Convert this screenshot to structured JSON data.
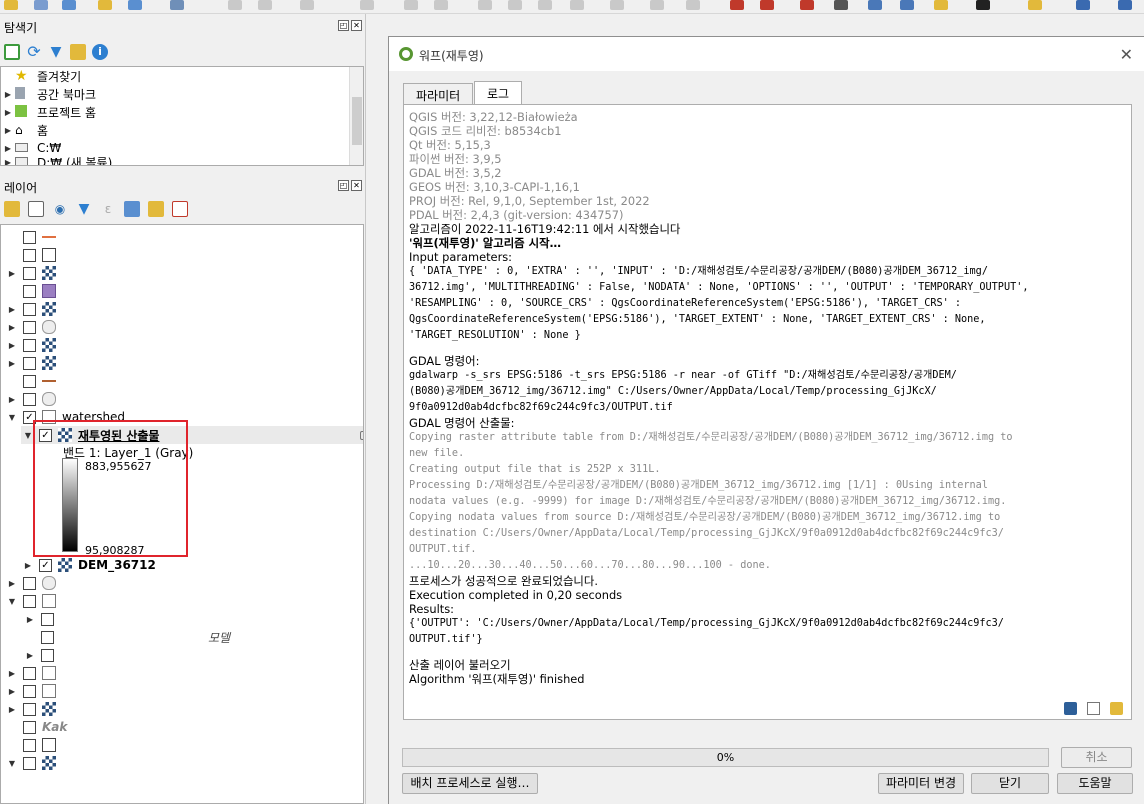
{
  "browser_panel": {
    "title": "탐색기",
    "items": [
      {
        "label": "즐겨찾기",
        "icon": "star-icon"
      },
      {
        "label": "공간 북마크",
        "icon": "bookmark-icon"
      },
      {
        "label": "프로젝트 홈",
        "icon": "project-home-icon"
      },
      {
        "label": "홈",
        "icon": "home-icon"
      },
      {
        "label": "C:₩",
        "icon": "drive-icon"
      },
      {
        "label": "D:₩ (새 볼륨)",
        "icon": "drive-icon"
      }
    ]
  },
  "layers_panel": {
    "title": "레이어",
    "watershed_label": "watershed",
    "selected_layer": "재투영된 산출물",
    "band_label": "밴드 1: Layer_1 (Gray)",
    "max_value": "883,955627",
    "min_value": "95,908287",
    "dem_layer": "DEM_36712",
    "model_label": "모델",
    "kaka_label": "Kak"
  },
  "dialog": {
    "title": "워프(재투영)",
    "tabs": [
      "파라미터",
      "로그"
    ],
    "active_tab": "로그",
    "log": {
      "header_lines": [
        "QGIS 버전: 3,22,12-Białowieża",
        "QGIS 코드 리비전: b8534cb1",
        "Qt 버전: 5,15,3",
        "파이썬 버전: 3,9,5",
        "GDAL 버전: 3,5,2",
        "GEOS 버전: 3,10,3-CAPI-1,16,1",
        "PROJ 버전: Rel, 9,1,0, September 1st, 2022",
        "PDAL 버전: 2,4,3 (git-version: 434757)"
      ],
      "start_line": "알고리즘이 2022-11-16T19:42:11 에서 시작했습니다",
      "algo_start": "'워프(재투영)' 알고리즘 시작…",
      "input_params_label": "Input parameters:",
      "input_params": "{ 'DATA_TYPE' : 0, 'EXTRA' : '', 'INPUT' : 'D:/재해성검토/수문리공장/공개DEM/(B080)공개DEM_36712_img/\n36712.img', 'MULTITHREADING' : False, 'NODATA' : None, 'OPTIONS' : '', 'OUTPUT' : 'TEMPORARY_OUTPUT',\n'RESAMPLING' : 0, 'SOURCE_CRS' : QgsCoordinateReferenceSystem('EPSG:5186'), 'TARGET_CRS' :\nQgsCoordinateReferenceSystem('EPSG:5186'), 'TARGET_EXTENT' : None, 'TARGET_EXTENT_CRS' : None,\n'TARGET_RESOLUTION' : None }",
      "gdal_cmd_label": "GDAL 명령어:",
      "gdal_cmd": "gdalwarp -s_srs EPSG:5186 -t_srs EPSG:5186 -r near -of GTiff \"D:/재해성검토/수문리공장/공개DEM/\n(B080)공개DEM_36712_img/36712.img\" C:/Users/Owner/AppData/Local/Temp/processing_GjJKcX/\n9f0a0912d0ab4dcfbc82f69c244c9fc3/OUTPUT.tif",
      "gdal_output_label": "GDAL 명령어 산출물:",
      "gdal_output": "Copying raster attribute table from D:/재해성검토/수문리공장/공개DEM/(B080)공개DEM_36712_img/36712.img to\nnew file.\nCreating output file that is 252P x 311L.\nProcessing D:/재해성검토/수문리공장/공개DEM/(B080)공개DEM_36712_img/36712.img [1/1] : 0Using internal\nnodata values (e.g. -9999) for image D:/재해성검토/수문리공장/공개DEM/(B080)공개DEM_36712_img/36712.img.\nCopying nodata values from source D:/재해성검토/수문리공장/공개DEM/(B080)공개DEM_36712_img/36712.img to\ndestination C:/Users/Owner/AppData/Local/Temp/processing_GjJKcX/9f0a0912d0ab4dcfbc82f69c244c9fc3/\nOUTPUT.tif.\n...10...20...30...40...50...60...70...80...90...100 - done.",
      "success_line": "프로세스가 성공적으로 완료되었습니다.",
      "exec_line": "Execution completed in 0,20 seconds",
      "results_label": "Results:",
      "results": "{'OUTPUT': 'C:/Users/Owner/AppData/Local/Temp/processing_GjJKcX/9f0a0912d0ab4dcfbc82f69c244c9fc3/\nOUTPUT.tif'}",
      "load_line": "산출 레이어 불러오기",
      "finished_line": "Algorithm '워프(재투영)' finished"
    },
    "progress_text": "0%",
    "progress_fraction": 0,
    "buttons": {
      "cancel": "취소",
      "batch": "배치 프로세스로 실행…",
      "change_params": "파라미터 변경",
      "close": "닫기",
      "help": "도움말"
    }
  },
  "colors": {
    "accent": "#589632",
    "highlight": "#e0242c"
  }
}
